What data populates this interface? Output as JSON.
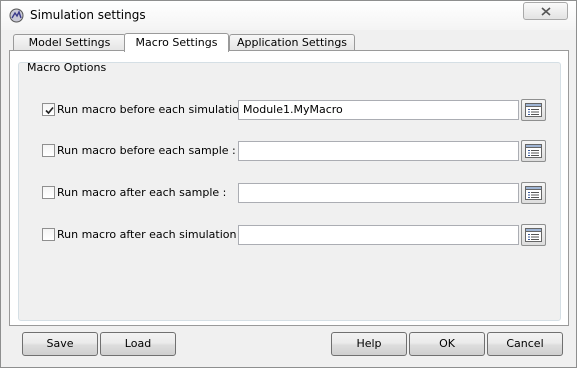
{
  "window": {
    "title": "Simulation settings"
  },
  "tabs": [
    {
      "label": "Model Settings",
      "active": false
    },
    {
      "label": "Macro Settings",
      "active": true
    },
    {
      "label": "Application Settings",
      "active": false
    }
  ],
  "macro_options": {
    "group_title": "Macro Options",
    "rows": [
      {
        "label": "Run macro before each simulation :",
        "checked": true,
        "value": "Module1.MyMacro"
      },
      {
        "label": "Run macro before each sample :",
        "checked": false,
        "value": ""
      },
      {
        "label": "Run macro after each sample :",
        "checked": false,
        "value": ""
      },
      {
        "label": "Run macro after each simulation :",
        "checked": false,
        "value": ""
      }
    ]
  },
  "footer": {
    "save_label": "Save",
    "load_label": "Load",
    "help_label": "Help",
    "ok_label": "OK",
    "cancel_label": "Cancel"
  },
  "icons": {
    "app": "simulation-app-icon",
    "close": "close-icon",
    "browse": "macro-list-icon"
  }
}
